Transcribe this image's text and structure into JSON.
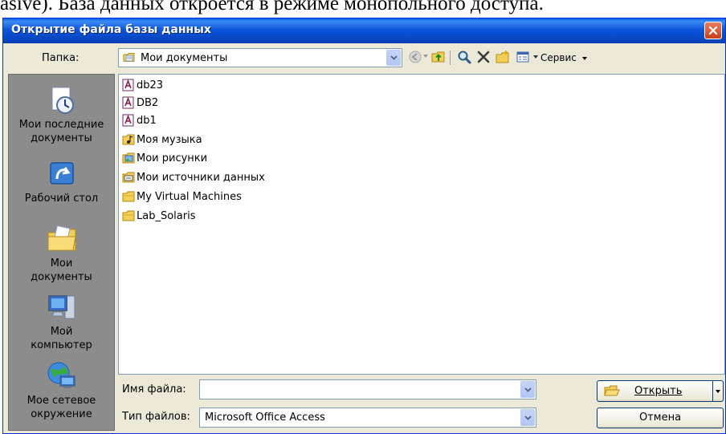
{
  "document_text": "asive). База данных откроется в режиме монопольного доступа.",
  "dialog": {
    "title": "Открытие файла базы данных"
  },
  "folder": {
    "label": "Папка:",
    "value": "Мои документы"
  },
  "toolbar": {
    "tools_label": "Сервис"
  },
  "places": [
    {
      "label": "Мои последние документы",
      "icon": "recent-documents-icon"
    },
    {
      "label": "Рабочий стол",
      "icon": "desktop-icon"
    },
    {
      "label": "Мои документы",
      "icon": "my-documents-icon"
    },
    {
      "label": "Мой компьютер",
      "icon": "my-computer-icon"
    },
    {
      "label": "Мое сетевое окружение",
      "icon": "network-icon"
    }
  ],
  "files": [
    {
      "name": "db23",
      "icon": "access-db-icon"
    },
    {
      "name": "DB2",
      "icon": "access-db-icon"
    },
    {
      "name": "db1",
      "icon": "access-db-icon"
    },
    {
      "name": "Моя музыка",
      "icon": "music-folder-icon"
    },
    {
      "name": "Мои рисунки",
      "icon": "pictures-folder-icon"
    },
    {
      "name": "Мои источники данных",
      "icon": "data-sources-folder-icon"
    },
    {
      "name": "My Virtual Machines",
      "icon": "folder-icon"
    },
    {
      "name": "Lab_Solaris",
      "icon": "folder-icon"
    }
  ],
  "filename": {
    "label": "Имя файла:",
    "value": ""
  },
  "filetype": {
    "label": "Тип файлов:",
    "value": "Microsoft Office Access"
  },
  "buttons": {
    "open": "Открыть",
    "cancel": "Отмена"
  },
  "colors": {
    "titlebar": "#0a50d8",
    "dialog_bg": "#ece9d8",
    "places_bg": "#8c8c8c"
  }
}
